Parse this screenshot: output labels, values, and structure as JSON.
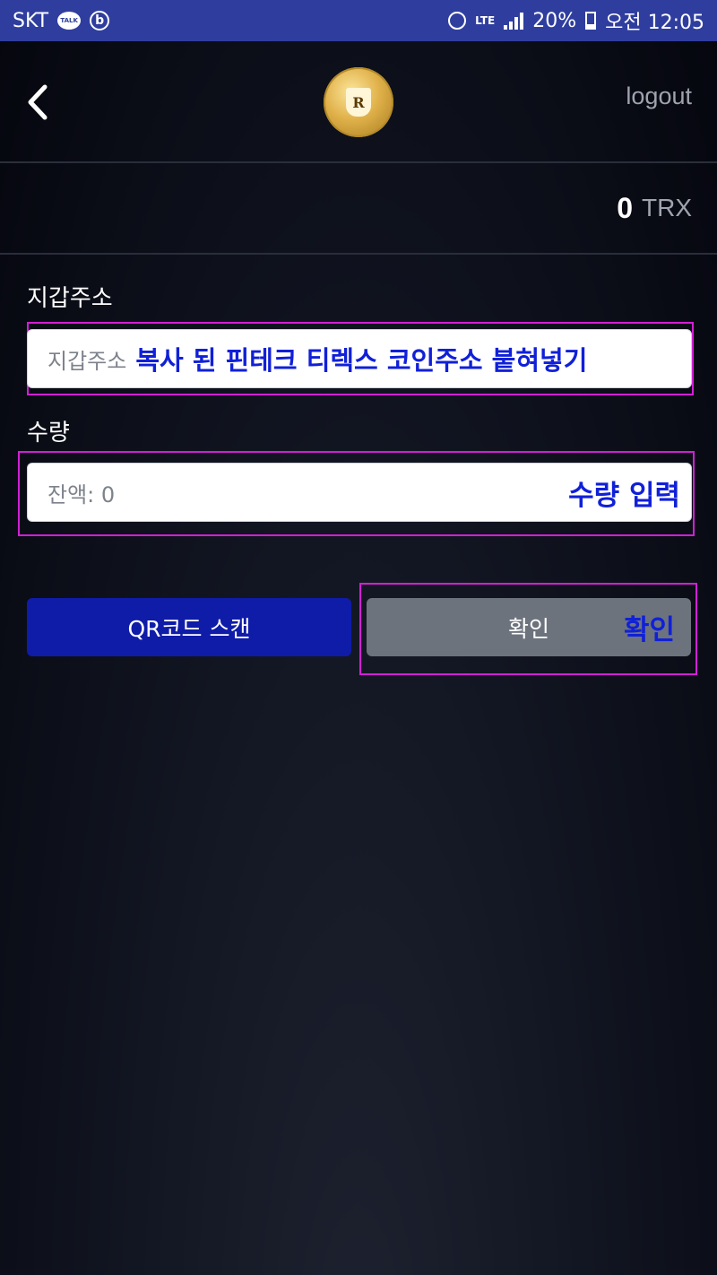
{
  "status_bar": {
    "carrier": "SKT",
    "talk_badge": "TALK",
    "b_badge": "b",
    "lte": "LTE",
    "battery": "20%",
    "time": "오전 12:05"
  },
  "header": {
    "logo_letter": "R",
    "logout_label": "logout"
  },
  "balance": {
    "amount": "0",
    "unit": "TRX"
  },
  "wallet": {
    "label": "지갑주소",
    "placeholder": "지갑주소",
    "annotation": "복사 된 핀테크 티렉스 코인주소 붙혀넣기"
  },
  "quantity": {
    "label": "수량",
    "placeholder": "잔액: 0",
    "annotation": "수량 입력"
  },
  "buttons": {
    "qr_scan": "QR코드 스캔",
    "confirm": "확인",
    "confirm_annotation": "확인"
  },
  "colors": {
    "status_bar": "#2f3e9e",
    "qr_button": "#0f1ca8",
    "confirm_button": "#6c737d",
    "annotation_border": "#d21fd6",
    "annotation_text": "#1020d8"
  }
}
